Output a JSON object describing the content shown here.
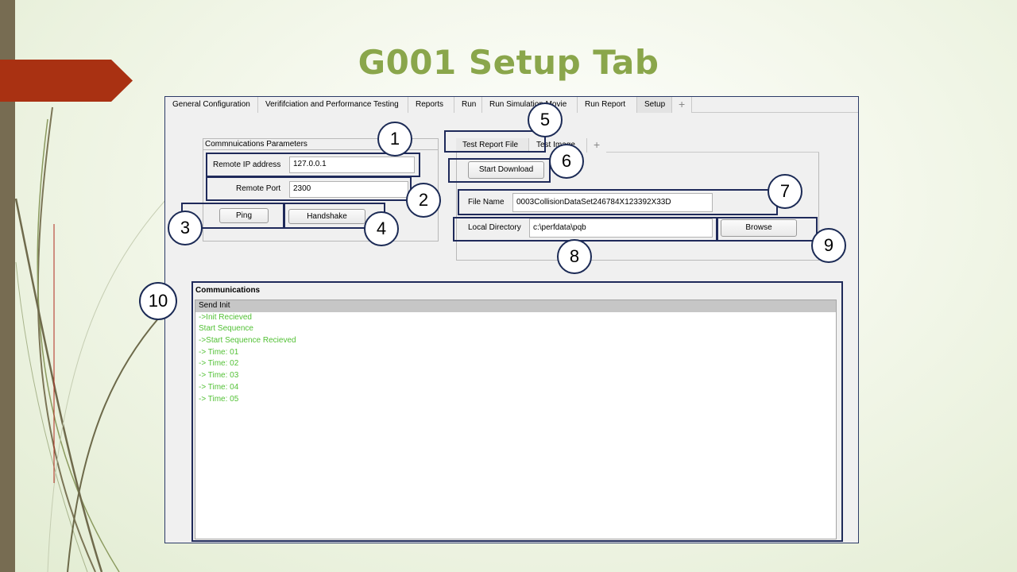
{
  "slide": {
    "title": "G001 Setup Tab"
  },
  "app": {
    "main_tabs": [
      {
        "label": "General Configuration"
      },
      {
        "label": "Verififciation and Performance Testing"
      },
      {
        "label": "Reports"
      },
      {
        "label": "Run"
      },
      {
        "label": "Run Simulation Movie"
      },
      {
        "label": "Run Report"
      },
      {
        "label": "Setup"
      }
    ],
    "active_tab": "Setup",
    "add_tab_label": "+",
    "comm_params": {
      "title": "Commnuications Parameters",
      "remote_ip_label": "Remote IP address",
      "remote_ip_value": "127.0.0.1",
      "remote_port_label": "Remote Port",
      "remote_port_value": "2300",
      "ping_label": "Ping",
      "handshake_label": "Handshake"
    },
    "report_tabs": [
      {
        "label": "Test Report File"
      },
      {
        "label": "Test Image"
      }
    ],
    "report_add_tab_label": "+",
    "download": {
      "start_download_label": "Start Download",
      "file_name_label": "File Name",
      "file_name_value": "0003CollisionDataSet246784X123392X33D",
      "local_directory_label": "Local Directory",
      "local_directory_value": "c:\\perfdata\\pqb",
      "browse_label": "Browse"
    },
    "communications": {
      "title": "Communications",
      "rows": [
        "Send Init",
        "->Init Recieved",
        "Start Sequence",
        "->Start Sequence Recieved",
        "-> Time: 01",
        "-> Time: 02",
        "-> Time: 03",
        "-> Time: 04",
        "-> Time: 05"
      ]
    }
  },
  "callouts": {
    "c1": "1",
    "c2": "2",
    "c3": "3",
    "c4": "4",
    "c5": "5",
    "c6": "6",
    "c7": "7",
    "c8": "8",
    "c9": "9",
    "c10": "10"
  },
  "colors": {
    "title": "#8aa64b",
    "left_bar": "#776c52",
    "arrow": "#a93112",
    "callout_border": "#1f2a5a",
    "log_text": "#53c136"
  }
}
